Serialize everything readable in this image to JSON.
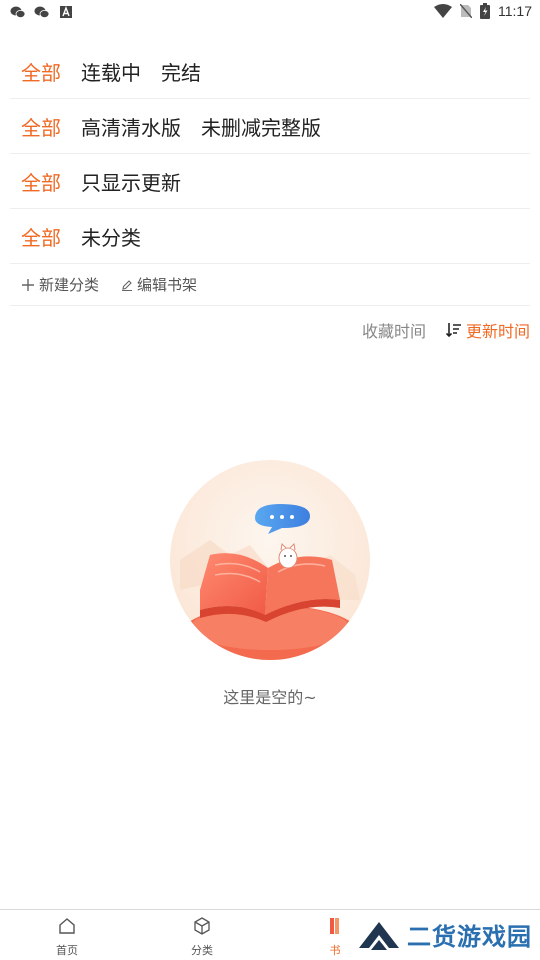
{
  "status_bar": {
    "time": "11:17"
  },
  "filters": [
    {
      "items": [
        "全部",
        "连载中",
        "完结"
      ]
    },
    {
      "items": [
        "全部",
        "高清清水版",
        "未删减完整版"
      ]
    },
    {
      "items": [
        "全部",
        "只显示更新"
      ]
    },
    {
      "items": [
        "全部",
        "未分类"
      ]
    }
  ],
  "actions": {
    "new_category": "新建分类",
    "edit_shelf": "编辑书架"
  },
  "sort": {
    "collect_time": "收藏时间",
    "update_time": "更新时间"
  },
  "empty_text": "这里是空的~",
  "nav": [
    {
      "label": "首页",
      "icon": "home-icon"
    },
    {
      "label": "分类",
      "icon": "cube-icon"
    },
    {
      "label": "书",
      "icon": "books-icon"
    }
  ],
  "watermark": "二货游戏园",
  "colors": {
    "accent": "#f06a24",
    "divider": "#eeeeee"
  }
}
